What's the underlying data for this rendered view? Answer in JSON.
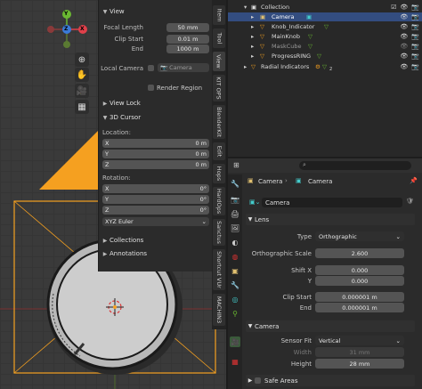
{
  "npanel": {
    "view_title": "View",
    "focal_length_label": "Focal Length",
    "focal_length_value": "50 mm",
    "clip_start_label": "Clip Start",
    "clip_start_value": "0.01 m",
    "end_label": "End",
    "end_value": "1000 m",
    "local_camera_label": "Local Camera",
    "local_camera_value": "Camera",
    "render_region_label": "Render Region",
    "view_lock_title": "View Lock",
    "cursor_title": "3D Cursor",
    "location_label": "Location:",
    "location": [
      {
        "axis": "X",
        "value": "0 m"
      },
      {
        "axis": "Y",
        "value": "0 m"
      },
      {
        "axis": "Z",
        "value": "0 m"
      }
    ],
    "rotation_label": "Rotation:",
    "rotation": [
      {
        "axis": "X",
        "value": "0°"
      },
      {
        "axis": "Y",
        "value": "0°"
      },
      {
        "axis": "Z",
        "value": "0°"
      }
    ],
    "rotation_mode": "XYZ Euler",
    "collections_title": "Collections",
    "annotations_title": "Annotations"
  },
  "vtabs": [
    "Item",
    "Tool",
    "View",
    "KIT OPS",
    "BlenderKit",
    "Edit",
    "Hops",
    "HardOps",
    "Sanctus",
    "Shortcut VUr",
    "MACHIN3"
  ],
  "outliner": {
    "rows": [
      {
        "name": "Collection",
        "depth": 0,
        "selected": false
      },
      {
        "name": "Camera",
        "depth": 1,
        "selected": true
      },
      {
        "name": "Knob_Indicator",
        "depth": 1,
        "selected": false
      },
      {
        "name": "MainKnob",
        "depth": 1,
        "selected": false
      },
      {
        "name": "MaskCube",
        "depth": 1,
        "selected": false
      },
      {
        "name": "ProgressRING",
        "depth": 1,
        "selected": false
      },
      {
        "name": "Radial Indicators",
        "depth": 0,
        "selected": false
      }
    ],
    "radial_badge": "2"
  },
  "properties": {
    "header_object": "Camera",
    "header_data": "Camera",
    "data_name": "Camera",
    "lens_title": "Lens",
    "type_label": "Type",
    "type_value": "Orthographic",
    "ortho_scale_label": "Orthographic Scale",
    "ortho_scale_value": "2.600",
    "shift_x_label": "Shift X",
    "shift_x_value": "0.000",
    "shift_y_label": "Y",
    "shift_y_value": "0.000",
    "clip_start_label": "Clip Start",
    "clip_start_value": "0.000001 m",
    "clip_end_label": "End",
    "clip_end_value": "0.000001 m",
    "camera_title": "Camera",
    "sensor_fit_label": "Sensor Fit",
    "sensor_fit_value": "Vertical",
    "width_label": "Width",
    "width_value": "31 mm",
    "height_label": "Height",
    "height_value": "28 mm",
    "safe_areas_label": "Safe Areas"
  },
  "gizmo": {
    "x": "X",
    "y": "Y",
    "z": "Z"
  },
  "colors": {
    "accent_orange": "#f5a020",
    "selection_blue": "#334d80",
    "x_red": "#e0404a",
    "y_green": "#6ab832",
    "z_blue": "#3a7ad8"
  }
}
